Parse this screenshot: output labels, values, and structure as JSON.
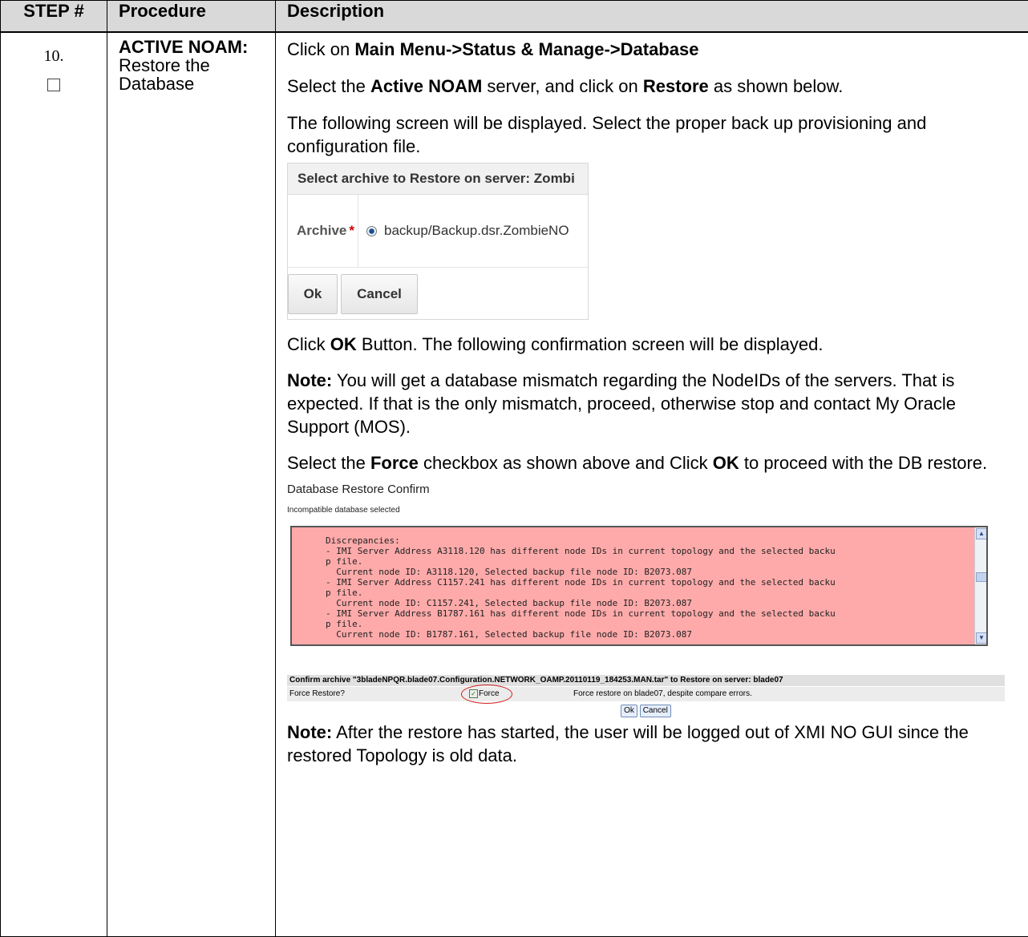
{
  "header": {
    "step": "STEP #",
    "procedure": "Procedure",
    "description": "Description"
  },
  "step": {
    "number": "10.",
    "proc_title": "ACTIVE NOAM:",
    "proc_desc": "Restore the Database"
  },
  "desc": {
    "p1_pre": "Click on ",
    "p1_bold": "Main Menu->Status & Manage->Database",
    "p2_pre": "Select the ",
    "p2_b1": "Active NOAM",
    "p2_mid": " server, and click on ",
    "p2_b2": "Restore",
    "p2_post": " as shown below.",
    "p3": "The following screen will be displayed. Select the proper back up provisioning and configuration file.",
    "p4_pre": "Click ",
    "p4_bold": "OK",
    "p4_post": " Button. The following confirmation screen will be displayed.",
    "p5_bold": "Note:",
    "p5_rest": " You will get a database mismatch regarding the NodeIDs of the servers. That is expected. If that is the only mismatch, proceed, otherwise stop and contact My Oracle Support (MOS).",
    "p6_pre": "Select the ",
    "p6_b1": "Force",
    "p6_mid": " checkbox as shown above and Click ",
    "p6_b2": "OK",
    "p6_post": " to proceed with the DB restore.",
    "p7_bold": "Note:",
    "p7_rest": " After the restore has started, the user will be logged out of XMI NO GUI since the restored Topology is old data."
  },
  "dialog1": {
    "title": "Select archive to Restore on server: Zombi",
    "archive_label": "Archive",
    "required_mark": "*",
    "archive_value": "backup/Backup.dsr.ZombieNO",
    "ok": "Ok",
    "cancel": "Cancel"
  },
  "dialog2": {
    "title": "Database Restore Confirm",
    "subtitle": "Incompatible database selected",
    "discrepancies": "Discrepancies:\n- IMI Server Address A3118.120 has different node IDs in current topology and the selected backu\np file.\n  Current node ID: A3118.120, Selected backup file node ID: B2073.087\n- IMI Server Address C1157.241 has different node IDs in current topology and the selected backu\np file.\n  Current node ID: C1157.241, Selected backup file node ID: B2073.087\n- IMI Server Address B1787.161 has different node IDs in current topology and the selected backu\np file.\n  Current node ID: B1787.161, Selected backup file node ID: B2073.087",
    "confirm_header": "Confirm archive \"3bladeNPQR.blade07.Configuration.NETWORK_OAMP.20110119_184253.MAN.tar\" to Restore on server: blade07",
    "force_question": "Force Restore?",
    "force_label": "Force",
    "force_message": "Force restore on blade07, despite compare errors.",
    "ok": "Ok",
    "cancel": "Cancel"
  }
}
